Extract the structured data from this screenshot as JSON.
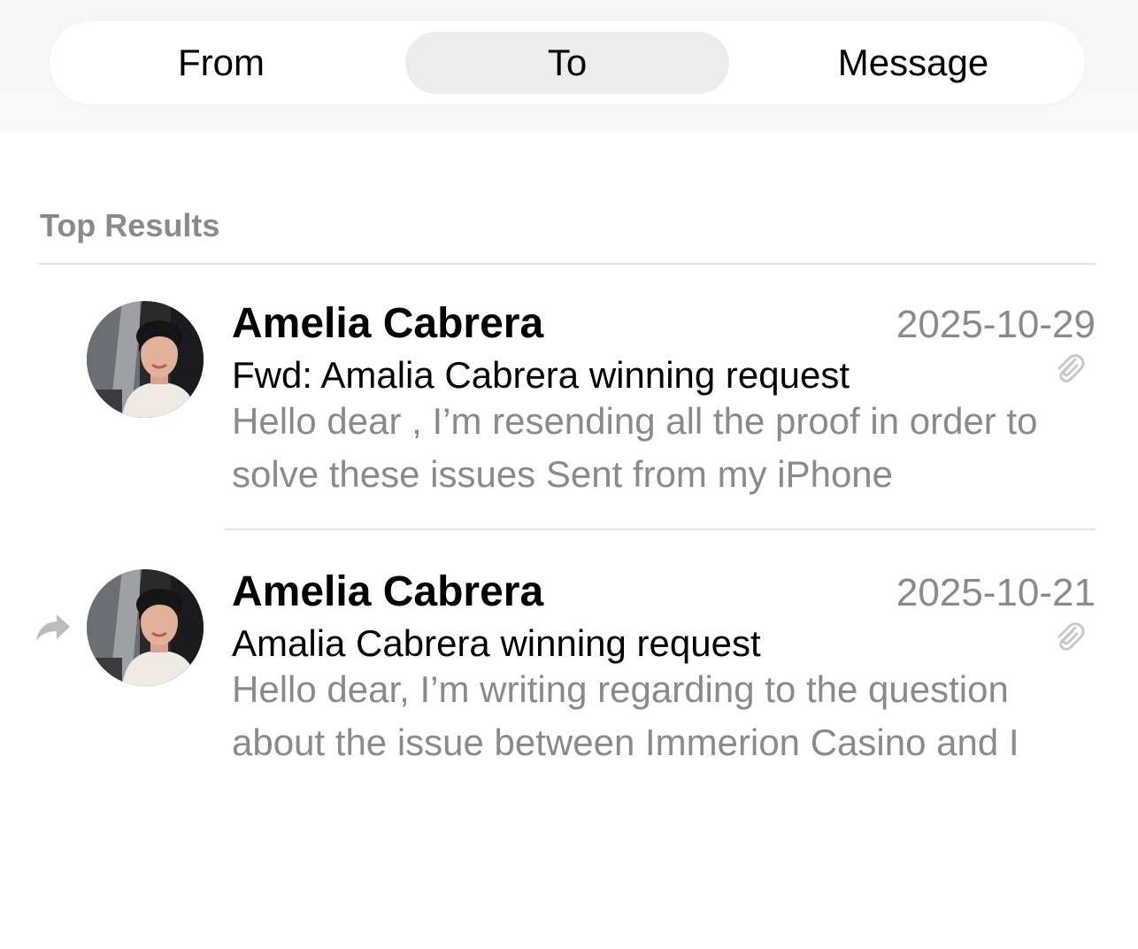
{
  "search_scope": {
    "tabs": [
      {
        "label": "From",
        "selected": false
      },
      {
        "label": "To",
        "selected": true
      },
      {
        "label": "Message",
        "selected": false
      }
    ]
  },
  "section": {
    "title": "Top Results"
  },
  "results": [
    {
      "sender": "Amelia Cabrera",
      "date": "2025-10-29",
      "subject": "Fwd: Amalia Cabrera winning request",
      "preview": "Hello dear , I’m resending all the proof in order to solve these issues Sent from my iPhone",
      "has_attachment": true,
      "forwarded": false,
      "avatar_icon": "contact-photo"
    },
    {
      "sender": "Amelia Cabrera",
      "date": "2025-10-21",
      "subject": "Amalia Cabrera winning request",
      "preview": "Hello dear, I’m writing regarding to the question about the issue between Immerion Casino and I",
      "has_attachment": true,
      "forwarded": true,
      "avatar_icon": "contact-photo"
    }
  ],
  "colors": {
    "secondary_text": "#8a8a8e",
    "selected_segment": "#ececec",
    "divider": "#e3e3e6"
  }
}
